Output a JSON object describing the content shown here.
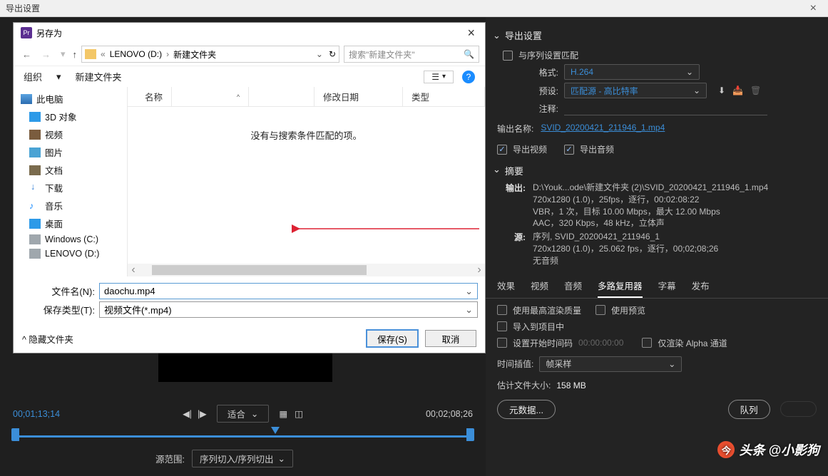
{
  "window": {
    "title": "导出设置"
  },
  "saveas": {
    "title": "另存为",
    "breadcrumbs": {
      "drive": "LENOVO (D:)",
      "folder": "新建文件夹"
    },
    "search_placeholder": "搜索\"新建文件夹\"",
    "toolbar": {
      "organize": "组织",
      "newfolder": "新建文件夹"
    },
    "columns": {
      "name": "名称",
      "date": "修改日期",
      "type": "类型"
    },
    "empty_msg": "没有与搜索条件匹配的项。",
    "tree": {
      "root": "此电脑",
      "items": [
        "3D 对象",
        "视频",
        "图片",
        "文档",
        "下载",
        "音乐",
        "桌面",
        "Windows (C:)",
        "LENOVO (D:)"
      ]
    },
    "filename_label": "文件名(N):",
    "filename_value": "daochu.mp4",
    "filetype_label": "保存类型(T):",
    "filetype_value": "视频文件(*.mp4)",
    "hide_folders": "^ 隐藏文件夹",
    "save_btn": "保存(S)",
    "cancel_btn": "取消"
  },
  "export": {
    "settings_head": "导出设置",
    "match_seq": "与序列设置匹配",
    "format_label": "格式:",
    "format_value": "H.264",
    "preset_label": "预设:",
    "preset_value": "匹配源 - 高比特率",
    "comment_label": "注释:",
    "outname_label": "输出名称:",
    "outname_value": "SVID_20200421_211946_1.mp4",
    "export_video": "导出视频",
    "export_audio": "导出音频",
    "summary_head": "摘要",
    "output_label": "输出:",
    "output_lines": [
      "D:\\Youk...ode\\新建文件夹 (2)\\SVID_20200421_211946_1.mp4",
      "720x1280 (1.0)，25fps，逐行，00:02:08:22",
      "VBR，1 次，目标 10.00 Mbps，最大 12.00 Mbps",
      "AAC，320 Kbps，48 kHz，立体声"
    ],
    "source_label": "源:",
    "source_lines": [
      "序列, SVID_20200421_211946_1",
      "720x1280 (1.0)，25.062 fps，逐行，00;02;08;26",
      "无音频"
    ],
    "tabs": [
      "效果",
      "视频",
      "音频",
      "多路复用器",
      "字幕",
      "发布"
    ],
    "active_tab": 3,
    "opt_maxquality": "使用最高渲染质量",
    "opt_preview": "使用预览",
    "opt_import": "导入到项目中",
    "opt_start": "设置开始时间码",
    "opt_start_tc": "00:00:00:00",
    "opt_alpha": "仅渲染 Alpha 通道",
    "interp_label": "时间插值:",
    "interp_value": "帧采样",
    "est_label": "估计文件大小:",
    "est_value": "158 MB",
    "metadata_btn": "元数据...",
    "queue_btn": "队列"
  },
  "timeline": {
    "tc_in": "00;01;13;14",
    "fit": "适合",
    "tc_out": "00;02;08;26",
    "range_label": "源范围:",
    "range_value": "序列切入/序列切出"
  },
  "watermark": {
    "text": "头条 @小影狗"
  }
}
